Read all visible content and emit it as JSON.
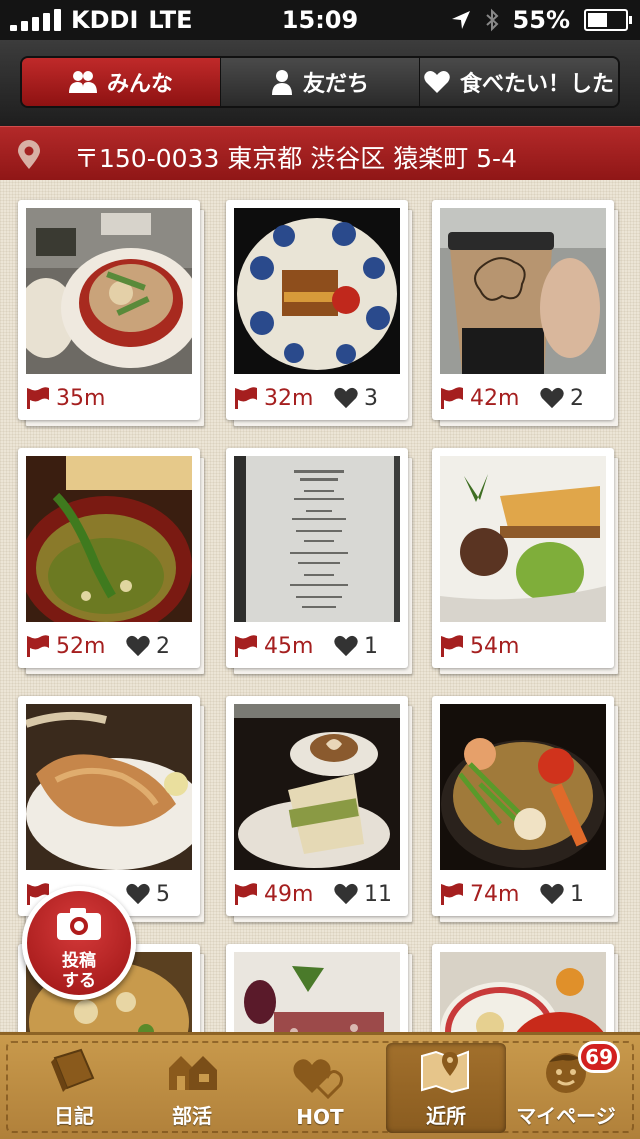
{
  "status_bar": {
    "carrier": "KDDI",
    "network": "LTE",
    "time": "15:09",
    "battery": "55%",
    "battery_level": 0.55
  },
  "segments": [
    {
      "label": "みんな",
      "icon": "people-icon",
      "active": true
    },
    {
      "label": "友だち",
      "icon": "person-icon",
      "active": false
    },
    {
      "label": "食べたい！した",
      "icon": "heart-icon",
      "active": false
    }
  ],
  "address": "〒150-0033 東京都 渋谷区 猿楽町 5-4",
  "cards": [
    {
      "distance": "35m",
      "likes": ""
    },
    {
      "distance": "32m",
      "likes": "3"
    },
    {
      "distance": "42m",
      "likes": "2"
    },
    {
      "distance": "52m",
      "likes": "2"
    },
    {
      "distance": "45m",
      "likes": "1"
    },
    {
      "distance": "54m",
      "likes": ""
    },
    {
      "distance": "",
      "likes": "5"
    },
    {
      "distance": "49m",
      "likes": "11"
    },
    {
      "distance": "74m",
      "likes": "1"
    },
    {
      "distance": "",
      "likes": ""
    },
    {
      "distance": "",
      "likes": ""
    },
    {
      "distance": "",
      "likes": ""
    }
  ],
  "post_button": {
    "line1": "投稿",
    "line2": "する"
  },
  "tab_bar": [
    {
      "label": "日記",
      "icon": "diary-icon"
    },
    {
      "label": "部活",
      "icon": "club-icon"
    },
    {
      "label": "HOT",
      "icon": "hot-heart-icon"
    },
    {
      "label": "近所",
      "icon": "map-icon",
      "active": true
    },
    {
      "label": "マイページ",
      "icon": "face-icon",
      "badge": "69"
    }
  ],
  "colors": {
    "accent": "#a51f1f",
    "tab_bar": "#c0903f",
    "header": "#1e1e1e"
  }
}
